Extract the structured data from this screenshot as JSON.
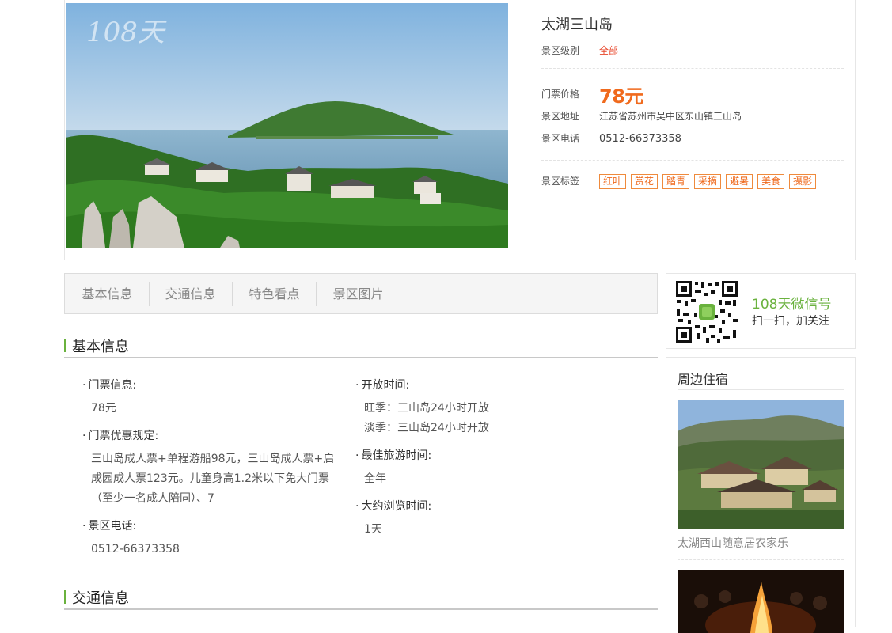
{
  "scenic": {
    "title": "太湖三山岛",
    "watermark": "108天",
    "level_label": "景区级别",
    "level_value": "全部",
    "price_label": "门票价格",
    "price_value": "78元",
    "address_label": "景区地址",
    "address_value": "江苏省苏州市吴中区东山镇三山岛",
    "phone_label": "景区电话",
    "phone_value": "0512-66373358",
    "tags_label": "景区标签",
    "tags": [
      "红叶",
      "赏花",
      "踏青",
      "采摘",
      "避暑",
      "美食",
      "摄影"
    ]
  },
  "tabs": [
    "基本信息",
    "交通信息",
    "特色看点",
    "景区图片"
  ],
  "basic_info": {
    "heading": "基本信息",
    "ticket_label": "门票信息:",
    "ticket_value": "78元",
    "discount_label": "门票优惠规定:",
    "discount_lines": [
      "三山岛成人票+单程游船98元，三山岛成人票+启",
      "成园成人票123元。儿童身高1.2米以下免大门票",
      "（至少一名成人陪同）、7"
    ],
    "phone_label": "景区电话:",
    "phone_value": "0512-66373358",
    "open_label": "开放时间:",
    "open_lines": [
      "旺季：三山岛24小时开放",
      "淡季：三山岛24小时开放"
    ],
    "best_label": "最佳旅游时间:",
    "best_value": "全年",
    "duration_label": "大约浏览时间:",
    "duration_value": "1天"
  },
  "traffic": {
    "heading": "交通信息"
  },
  "wechat": {
    "title": "108天微信号",
    "subtitle": "扫一扫，加关注"
  },
  "nearby": {
    "title": "周边住宿",
    "items": [
      {
        "caption": "太湖西山随意居农家乐"
      }
    ]
  },
  "colors": {
    "accent_green": "#6ab23e",
    "price_orange": "#f06a1d",
    "tag_orange": "#ef6a1d"
  }
}
